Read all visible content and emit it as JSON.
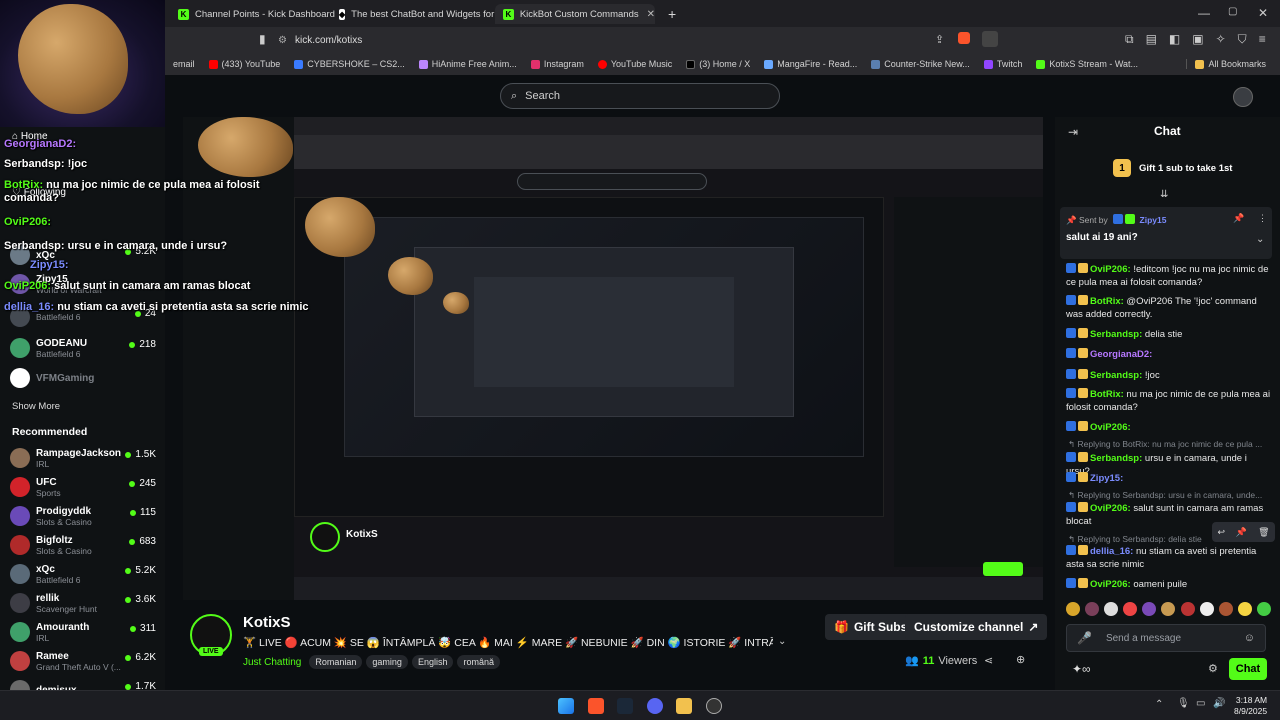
{
  "browser": {
    "tabs": [
      {
        "label": "Channel Points - Kick Dashboard",
        "icon": "kick-icon"
      },
      {
        "label": "The best ChatBot and Widgets for Ki",
        "icon": "botrix-icon"
      },
      {
        "label": "KickBot Custom Commands",
        "icon": "kick-icon"
      }
    ],
    "new_tab": "+",
    "url": "kick.com/kotixs",
    "bookmarks": [
      "email",
      "(433) YouTube",
      "CYBERSHOKE – CS2...",
      "HiAnime Free Anim...",
      "Instagram",
      "YouTube Music",
      "(3) Home / X",
      "MangaFire - Read...",
      "Counter-Strike New...",
      "Twitch",
      "KotixS Stream - Wat..."
    ],
    "all_bookmarks": "All Bookmarks",
    "colors": {
      "accent": "#53fc18",
      "bg": "#0b0e11"
    }
  },
  "search": {
    "placeholder": "Search"
  },
  "sidebar": {
    "nav": {
      "home": "Home",
      "following": "Following"
    },
    "following": [
      {
        "name": "xQc",
        "sub": "",
        "viewers": "5.2K"
      },
      {
        "name": "Zipy15",
        "sub": "World of Warcraft",
        "viewers": ""
      },
      {
        "name": "",
        "sub": "Battlefield 6",
        "viewers": "24"
      },
      {
        "name": "GODEANU",
        "sub": "Battlefield 6",
        "viewers": "218"
      },
      {
        "name": "VFMGaming",
        "sub": "",
        "viewers": ""
      }
    ],
    "show_more": "Show More",
    "recommended_title": "Recommended",
    "recommended": [
      {
        "name": "RampageJackson",
        "sub": "IRL",
        "viewers": "1.5K"
      },
      {
        "name": "UFC",
        "sub": "Sports",
        "viewers": "245"
      },
      {
        "name": "Prodigyddk",
        "sub": "Slots & Casino",
        "viewers": "115"
      },
      {
        "name": "Bigfoltz",
        "sub": "Slots & Casino",
        "viewers": "683"
      },
      {
        "name": "xQc",
        "sub": "Battlefield 6",
        "viewers": "5.2K"
      },
      {
        "name": "rellik",
        "sub": "Scavenger Hunt",
        "viewers": "3.6K"
      },
      {
        "name": "Amouranth",
        "sub": "IRL",
        "viewers": "311"
      },
      {
        "name": "Ramee",
        "sub": "Grand Theft Auto V (...",
        "viewers": "6.2K"
      },
      {
        "name": "demisux",
        "sub": "",
        "viewers": "1.7K"
      }
    ]
  },
  "overlay_chat": [
    {
      "user": "GeorgianaD2:",
      "text": ""
    },
    {
      "user": "Serbandsp:",
      "text": "!joc"
    },
    {
      "user": "BotRix:",
      "text": "nu ma joc nimic de ce pula mea ai folosit comanda?"
    },
    {
      "user": "OviP206:",
      "text": ""
    },
    {
      "user": "Serbandsp:",
      "text": "ursu e in camara, unde i ursu?"
    },
    {
      "user": "Zipy15:",
      "text": ""
    },
    {
      "user": "OviP206:",
      "text": "salut sunt in camara am ramas blocat"
    },
    {
      "user": "dellia_16:",
      "text": "nu stiam ca aveti si pretentia asta sa scrie nimic"
    }
  ],
  "stream": {
    "streamer": "KotixS",
    "title": "🏋️ LIVE 🔴 ACUM 💥 SE 😱 ÎNTÂMPLĂ 🤯 CEA 🔥 MAI ⚡ MARE 🚀 NEBUNIE 🚀 DIN 🌍 ISTORIE 🚀 INTRĂ 🏃 RE...",
    "category": "Just Chatting",
    "tags": [
      "Romanian",
      "gaming",
      "English",
      "română"
    ],
    "live_label": "LIVE",
    "gift_subs": "Gift Subs",
    "customize": "Customize channel",
    "viewers": "11",
    "viewers_label": "Viewers"
  },
  "chat": {
    "title": "Chat",
    "gift_banner": "Gift 1 sub to take 1st",
    "pinned": {
      "sent_by": "Sent by",
      "user": "Zipy15",
      "text": "salut ai 19 ani?"
    },
    "messages": [
      {
        "user": "OviP206:",
        "text": "!editcom !joc nu ma joc nimic de ce pula mea ai folosit comanda?",
        "color": "#53fc18"
      },
      {
        "user": "BotRix:",
        "text": "@OviP206 The '!joc' command was added correctly.",
        "color": "#53fc18"
      },
      {
        "user": "Serbandsp:",
        "text": "delia stie",
        "color": "#53fc18"
      },
      {
        "user": "GeorgianaD2:",
        "text": "",
        "color": "#b678ff"
      },
      {
        "user": "Serbandsp:",
        "text": "!joc",
        "color": "#53fc18"
      },
      {
        "user": "BotRix:",
        "text": "nu ma joc nimic de ce pula mea ai folosit comanda?",
        "color": "#53fc18"
      },
      {
        "user": "OviP206:",
        "text": "",
        "color": "#53fc18"
      },
      {
        "user": "Serbandsp:",
        "text": "ursu e in camara, unde i ursu?",
        "color": "#53fc18"
      },
      {
        "user": "Zipy15:",
        "text": "",
        "color": "#7b8cff"
      },
      {
        "user": "OviP206:",
        "text": "salut sunt in camara am ramas blocat",
        "color": "#53fc18"
      },
      {
        "user": "dellia_16:",
        "text": "nu stiam ca aveti si pretentia asta sa scrie nimic",
        "color": "#7b8cff"
      },
      {
        "user": "OviP206:",
        "text": "oameni puile",
        "color": "#53fc18"
      }
    ],
    "replies": [
      "Replying to BotRix: nu ma joc nimic de ce pula ...",
      "Replying to Serbandsp: ursu e in camara, unde...",
      "Replying to Serbandsp: delia stie"
    ],
    "send_placeholder": "Send a message",
    "chat_button": "Chat"
  },
  "taskbar": {
    "time": "3:18 AM",
    "date": "8/9/2025"
  }
}
